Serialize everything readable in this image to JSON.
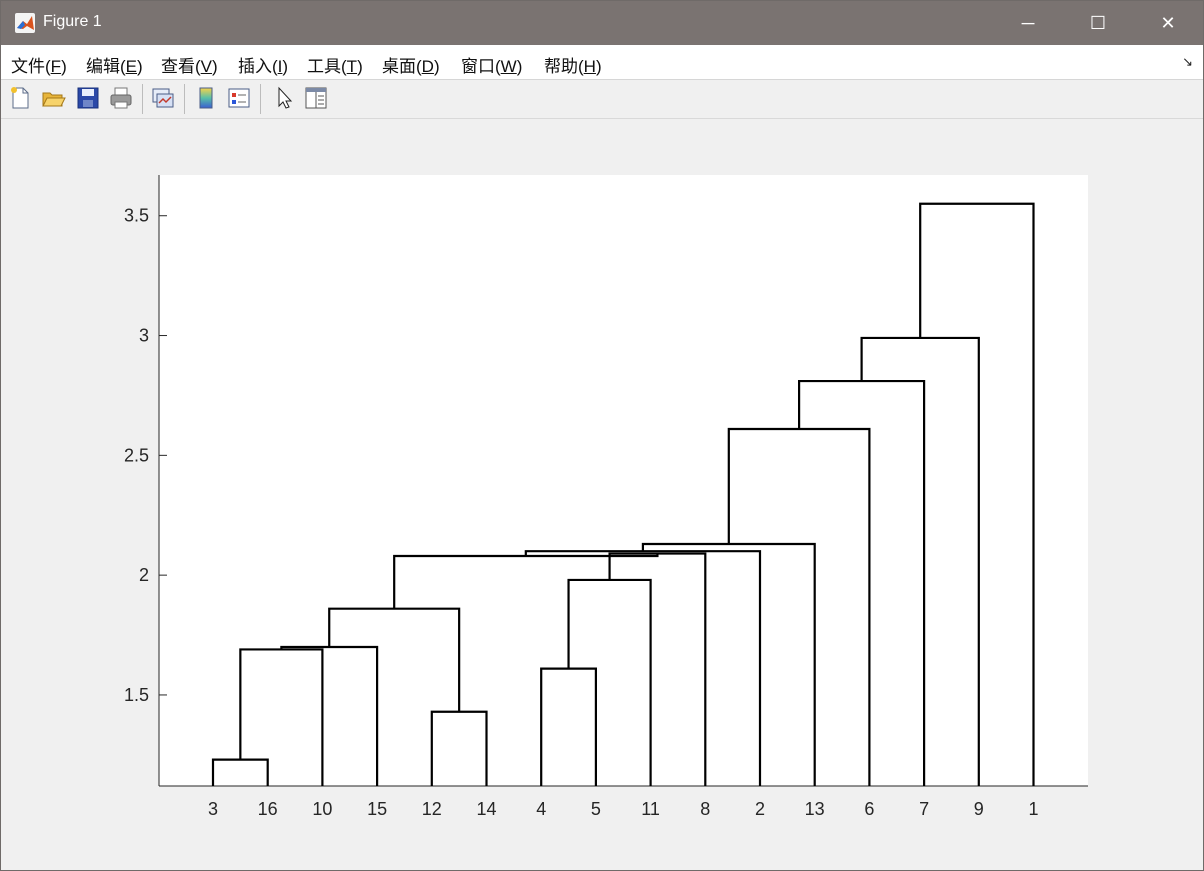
{
  "window": {
    "title": "Figure 1",
    "controls": {
      "minimize": "─",
      "maximize": "☐",
      "close": "✕"
    }
  },
  "menubar": {
    "items": [
      {
        "label": "文件(",
        "key": "F",
        "tail": ")"
      },
      {
        "label": "编辑(",
        "key": "E",
        "tail": ")"
      },
      {
        "label": "查看(",
        "key": "V",
        "tail": ")"
      },
      {
        "label": "插入(",
        "key": "I",
        "tail": ")"
      },
      {
        "label": "工具(",
        "key": "T",
        "tail": ")"
      },
      {
        "label": "桌面(",
        "key": "D",
        "tail": ")"
      },
      {
        "label": "窗口(",
        "key": "W",
        "tail": ")"
      },
      {
        "label": "帮助(",
        "key": "H",
        "tail": ")"
      }
    ],
    "dock_arrow": "↘"
  },
  "toolbar": {
    "icons": [
      "new-figure-icon",
      "open-file-icon",
      "save-icon",
      "print-icon",
      "link-plot-icon",
      "colorbar-icon",
      "legend-icon",
      "pointer-icon",
      "property-inspector-icon"
    ]
  },
  "chart_data": {
    "type": "dendrogram",
    "title": "",
    "xlabel": "",
    "ylabel": "",
    "leaf_order": [
      "3",
      "16",
      "10",
      "15",
      "12",
      "14",
      "4",
      "5",
      "11",
      "8",
      "2",
      "13",
      "6",
      "7",
      "9",
      "1"
    ],
    "yticks": [
      "1.5",
      "2",
      "2.5",
      "3",
      "3.5"
    ],
    "ylim": [
      1.12,
      3.67
    ],
    "baseline": 1.12,
    "line_color": "#000000",
    "merges": [
      {
        "left": [
          "3"
        ],
        "right": [
          "16"
        ],
        "height": 1.23
      },
      {
        "left": [
          "12"
        ],
        "right": [
          "14"
        ],
        "height": 1.43
      },
      {
        "left": [
          "4"
        ],
        "right": [
          "5"
        ],
        "height": 1.61
      },
      {
        "left": [
          "3",
          "16"
        ],
        "right": [
          "10"
        ],
        "height": 1.69
      },
      {
        "left": [
          "3",
          "16",
          "10"
        ],
        "right": [
          "15"
        ],
        "height": 1.7
      },
      {
        "left": [
          "3",
          "16",
          "10",
          "15"
        ],
        "right": [
          "12",
          "14"
        ],
        "height": 1.86
      },
      {
        "left": [
          "4",
          "5"
        ],
        "right": [
          "11"
        ],
        "height": 1.98
      },
      {
        "left": [
          "4",
          "5",
          "11"
        ],
        "right": [
          "8"
        ],
        "height": 2.09
      },
      {
        "left": [
          "3",
          "16",
          "10",
          "15",
          "12",
          "14"
        ],
        "right": [
          "4",
          "5",
          "11",
          "8"
        ],
        "height": 2.08
      },
      {
        "left": [
          "3",
          "16",
          "10",
          "15",
          "12",
          "14",
          "4",
          "5",
          "11",
          "8"
        ],
        "right": [
          "2"
        ],
        "height": 2.1
      },
      {
        "left": [
          "3",
          "16",
          "10",
          "15",
          "12",
          "14",
          "4",
          "5",
          "11",
          "8",
          "2"
        ],
        "right": [
          "13"
        ],
        "height": 2.13
      },
      {
        "left": [
          "3",
          "16",
          "10",
          "15",
          "12",
          "14",
          "4",
          "5",
          "11",
          "8",
          "2",
          "13"
        ],
        "right": [
          "6"
        ],
        "height": 2.61
      },
      {
        "left": [
          "3",
          "16",
          "10",
          "15",
          "12",
          "14",
          "4",
          "5",
          "11",
          "8",
          "2",
          "13",
          "6"
        ],
        "right": [
          "7"
        ],
        "height": 2.81
      },
      {
        "left": [
          "3",
          "16",
          "10",
          "15",
          "12",
          "14",
          "4",
          "5",
          "11",
          "8",
          "2",
          "13",
          "6",
          "7"
        ],
        "right": [
          "9"
        ],
        "height": 2.99
      },
      {
        "left": [
          "3",
          "16",
          "10",
          "15",
          "12",
          "14",
          "4",
          "5",
          "11",
          "8",
          "2",
          "13",
          "6",
          "7",
          "9"
        ],
        "right": [
          "1"
        ],
        "height": 3.55
      }
    ]
  }
}
